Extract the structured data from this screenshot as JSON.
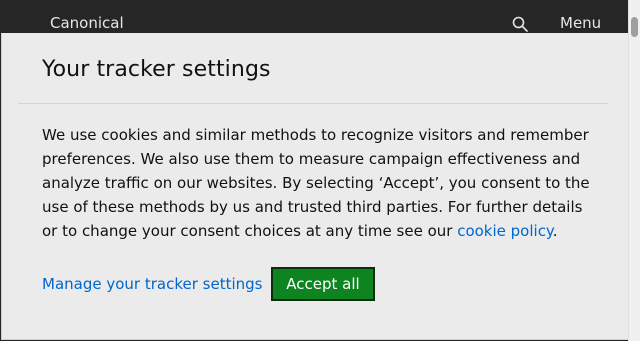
{
  "topbar": {
    "brand": "Canonical",
    "menu_label": "Menu",
    "search_icon": "search-icon"
  },
  "dialog": {
    "title": "Your tracker settings",
    "body_text": "We use cookies and similar methods to recognize visitors and remember preferences. We also use them to measure campaign effectiveness and analyze traffic on our websites. By selecting ‘Accept’, you consent to the use of these methods by us and trusted third parties. For further details or to change your consent choices at any time see our ",
    "policy_link": "cookie policy",
    "body_end": ".",
    "manage_link": "Manage your tracker settings",
    "accept_button": "Accept all"
  },
  "colors": {
    "accent_link": "#0066cc",
    "accept_bg": "#0e8420",
    "topbar_bg": "#262626",
    "dialog_bg": "#ebebeb"
  }
}
